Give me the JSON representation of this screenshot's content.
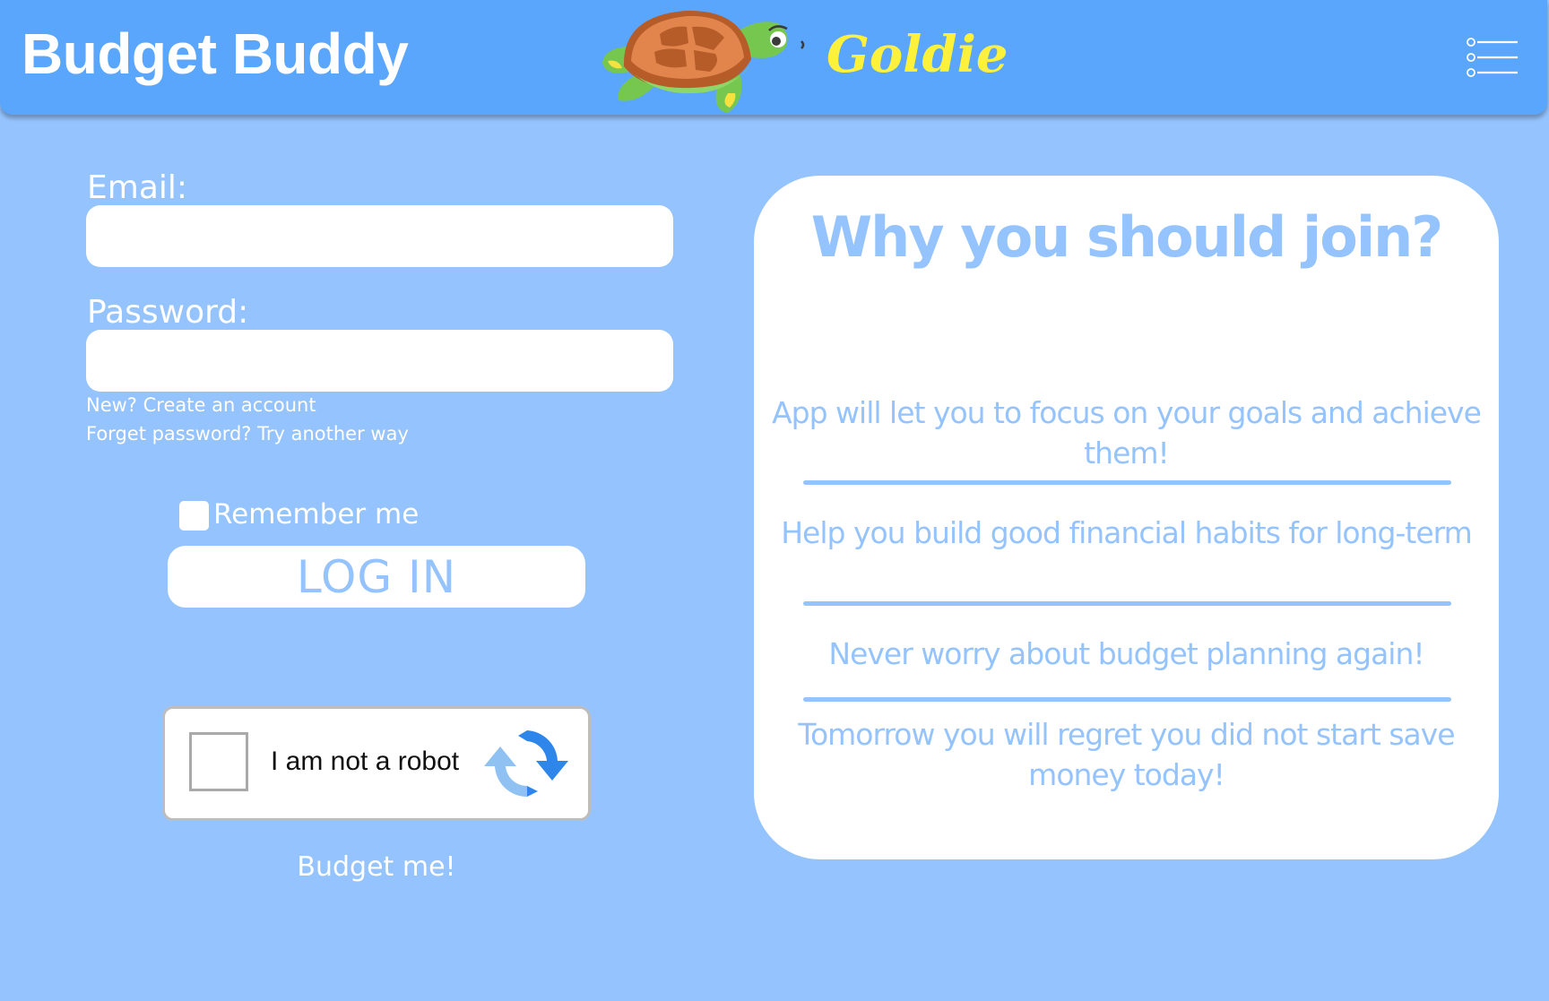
{
  "header": {
    "app_title": "Budget Buddy",
    "brand_name": "Goldie",
    "mascot_icon": "turtle-mascot-icon",
    "menu_icon": "list-menu-icon"
  },
  "login_form": {
    "email_label": "Email:",
    "email_value": "",
    "email_placeholder": "",
    "password_label": "Password:",
    "password_value": "",
    "password_placeholder": "",
    "create_account_link": "New? Create an account",
    "forgot_password_link": "Forget password? Try another way",
    "remember_me_label": "Remember me",
    "remember_me_checked": false,
    "login_button_label": "LOG IN"
  },
  "captcha": {
    "label": "I am not a robot",
    "checked": false,
    "logo_icon": "recaptcha-icon"
  },
  "tagline": "Budget me!",
  "why_join": {
    "title": "Why you should join?",
    "benefits": [
      "App will let you to focus on your goals and achieve them!",
      "Help you build good financial habits for long-term",
      "Never worry about budget planning again!",
      "Tomorrow you will regret you did not start save money today!"
    ]
  },
  "colors": {
    "page_background": "#94c3fd",
    "header_background": "#5aa6fd",
    "brand_yellow": "#fdf13b",
    "accent_text": "#94c3fd",
    "white": "#ffffff",
    "captcha_blue": "#4a90e2"
  }
}
